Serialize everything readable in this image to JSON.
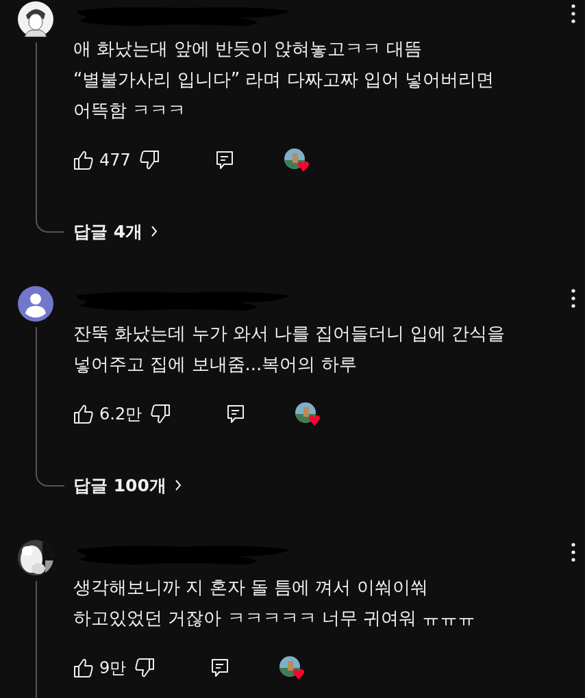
{
  "comments": [
    {
      "avatar": {
        "kind": "drawing"
      },
      "text": "애 화났는대 앞에 반듯이 앉혀놓고ㅋㅋ 대뜸\n“별불가사리 입니다” 라며 다짜고짜 입어 넣어버리면\n어뜩함 ㅋㅋㅋ",
      "likes": "477",
      "creator_hearted": true,
      "replies": "답글 4개"
    },
    {
      "avatar": {
        "kind": "default"
      },
      "text": "잔뚝 화났는데 누가 와서 나를 집어들더니 입에 간식을\n넣어주고 집에 보내줌...복어의 하루",
      "likes": "6.2만",
      "creator_hearted": true,
      "replies": "답글 100개"
    },
    {
      "text": "생각해보니까 지 혼자 돌 틈에 껴서 이쒀이쒀\n하고있었던 거잖아 ㅋㅋㅋㅋㅋ 너무 귀여워 ㅠㅠㅠ",
      "likes": "9만",
      "creator_hearted": true
    }
  ]
}
